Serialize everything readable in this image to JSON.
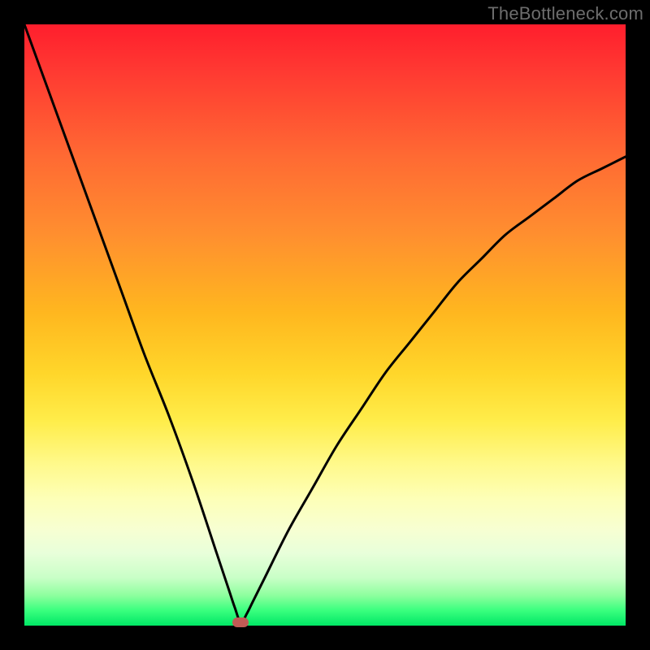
{
  "watermark": "TheBottleneck.com",
  "colors": {
    "frame": "#000000",
    "curve": "#000000",
    "marker": "#c15a55",
    "gradient_top": "#ff1e2d",
    "gradient_bottom": "#00e765"
  },
  "chart_data": {
    "type": "line",
    "title": "",
    "xlabel": "",
    "ylabel": "",
    "xlim": [
      0,
      100
    ],
    "ylim": [
      0,
      100
    ],
    "note": "Axes are normalized 0–100; no tick labels are shown in the image. y≈100 at top (red / high bottleneck), y≈0 at bottom (green / no bottleneck). Curve is a V-shaped bottleneck profile with its minimum near x≈36.",
    "series": [
      {
        "name": "bottleneck-curve",
        "x": [
          0,
          4,
          8,
          12,
          16,
          20,
          24,
          28,
          32,
          34,
          35,
          36,
          37,
          38,
          40,
          44,
          48,
          52,
          56,
          60,
          64,
          68,
          72,
          76,
          80,
          84,
          88,
          92,
          96,
          100
        ],
        "y": [
          100,
          89,
          78,
          67,
          56,
          45,
          35,
          24,
          12,
          6,
          3,
          0.5,
          2,
          4,
          8,
          16,
          23,
          30,
          36,
          42,
          47,
          52,
          57,
          61,
          65,
          68,
          71,
          74,
          76,
          78
        ]
      }
    ],
    "marker": {
      "x": 36,
      "y": 0.5
    }
  }
}
